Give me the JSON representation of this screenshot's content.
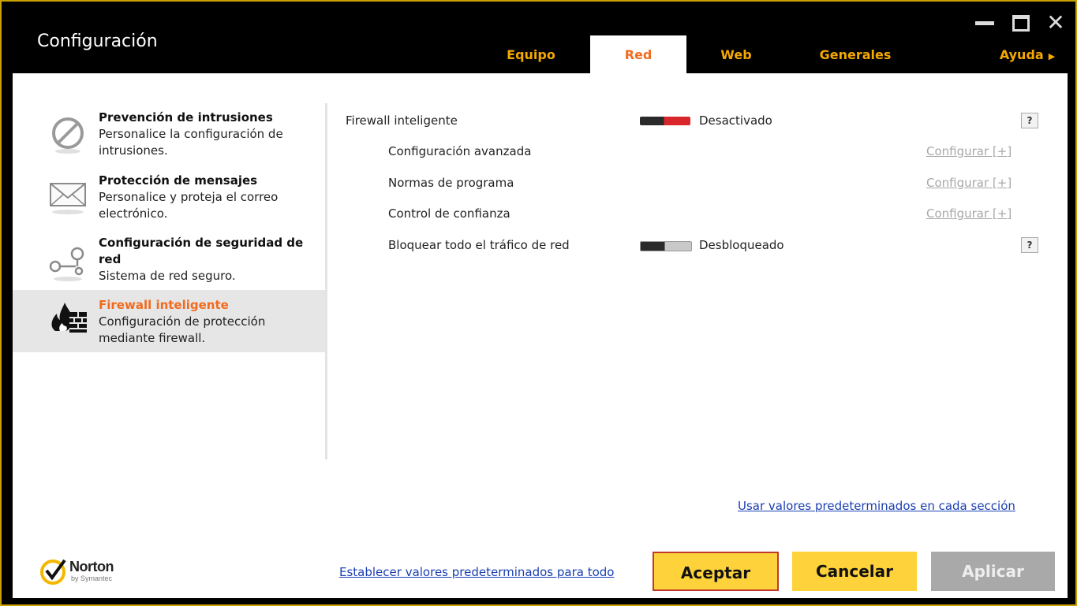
{
  "window": {
    "title": "Configuración",
    "controls": {
      "minimize": "minimize-icon",
      "maximize": "maximize-icon",
      "close": "close-icon"
    }
  },
  "tabs": [
    {
      "label": "Equipo",
      "active": false
    },
    {
      "label": "Red",
      "active": true
    },
    {
      "label": "Web",
      "active": false
    },
    {
      "label": "Generales",
      "active": false
    },
    {
      "label": "Ayuda",
      "active": false,
      "icon": "triangle-right-icon"
    }
  ],
  "sidebar": {
    "items": [
      {
        "title": "Prevención de intrusiones",
        "desc": "Personalice la configuración de intrusiones.",
        "icon": "prohibited-icon"
      },
      {
        "title": "Protección de mensajes",
        "desc": "Personalice y proteja el correo electrónico.",
        "icon": "envelope-icon"
      },
      {
        "title": "Configuración de seguridad de red",
        "desc": "Sistema de red seguro.",
        "icon": "network-icon"
      },
      {
        "title": "Firewall inteligente",
        "desc": "Configuración de protección mediante firewall.",
        "icon": "firewall-icon",
        "active": true
      }
    ]
  },
  "settings": {
    "firewall": {
      "label": "Firewall inteligente",
      "state": "Desactivado",
      "help": "?"
    },
    "advanced": {
      "label": "Configuración avanzada",
      "link": "Configurar [+]"
    },
    "program_rules": {
      "label": "Normas de programa",
      "link": "Configurar [+]"
    },
    "trust_control": {
      "label": "Control de confianza",
      "link": "Configurar [+]"
    },
    "block_all": {
      "label": "Bloquear todo el tráfico de red",
      "state": "Desbloqueado",
      "help": "?"
    }
  },
  "links": {
    "section_defaults": "Usar valores predeterminados en cada sección",
    "all_defaults": "Establecer valores predeterminados para todo"
  },
  "buttons": {
    "accept": "Aceptar",
    "cancel": "Cancelar",
    "apply": "Aplicar"
  },
  "brand": {
    "name": "Norton",
    "sub": "by Symantec"
  },
  "colors": {
    "accent": "#f26b1d",
    "tab_text": "#f5a800",
    "button": "#fdd23a",
    "toggle_off": "#d9262a",
    "link": "#1a3fb0"
  }
}
